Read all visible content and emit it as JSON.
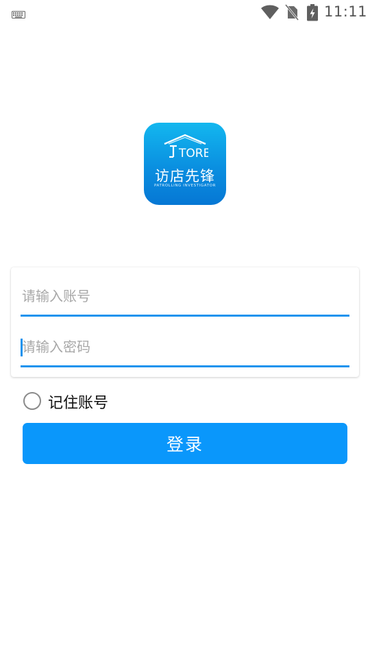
{
  "status_bar": {
    "time": "11:11",
    "icons": [
      "keyboard-icon",
      "wifi-icon",
      "no-sim-icon",
      "battery-charging-icon"
    ]
  },
  "logo": {
    "mark_text": "TORE",
    "name": "访店先锋",
    "tagline": "PATROLLING INVESTIGATOR"
  },
  "login": {
    "account_placeholder": "请输入账号",
    "account_value": "",
    "password_placeholder": "请输入密码",
    "password_value": "",
    "remember_label": "记住账号",
    "remember_checked": false,
    "submit_label": "登录"
  },
  "colors": {
    "accent": "#1a93ee",
    "button": "#0a97fb",
    "logo_top": "#13b7ef",
    "logo_bottom": "#0677d4"
  }
}
